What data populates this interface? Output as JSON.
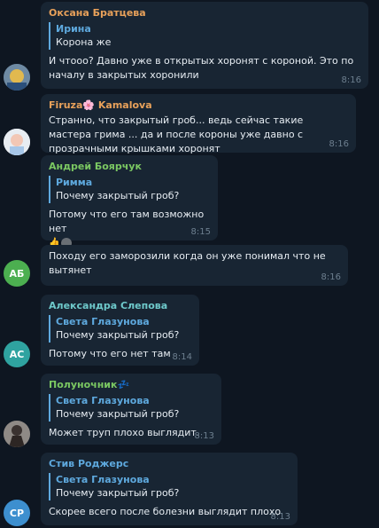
{
  "messages": [
    {
      "name": "Оксана Братцева",
      "name_color": "#e8a15a",
      "quote_name": "Ирина",
      "quote_text": "Корона же",
      "text": "И чтооо? Давно уже в открытых хоронят с короной. Это по началу в закрытых хоронили",
      "time": "8:16"
    },
    {
      "name": "Firuza🌸 Kamalova",
      "name_color": "#e8a15a",
      "text": "Странно, что закрытый гроб... ведь сейчас такие мастера грима ... да и после короны уже давно с прозрачными крышками хоронят",
      "time": "8:16"
    },
    {
      "name": "Андрей Боярчук",
      "name_color": "#7bc862",
      "quote_name": "Римма",
      "quote_text": "Почему закрытый гроб?",
      "text": "Потому что его там возможно нет",
      "reaction": "👍",
      "time": "8:15"
    },
    {
      "avatar_initials": "АБ",
      "avatar_color": "#4caf50",
      "text": "Походу его заморозили когда он уже понимал что не вытянет",
      "time": "8:16"
    },
    {
      "avatar_initials": "АС",
      "avatar_color": "#2fa3a0",
      "name": "Александра Слепова",
      "name_color": "#6ec9cb",
      "quote_name": "Света Глазунова",
      "quote_text": "Почему закрытый гроб?",
      "text": "Потому что его нет там",
      "time": "8:14"
    },
    {
      "name": "Полуночник💤",
      "name_color": "#7bc862",
      "quote_name": "Света Глазунова",
      "quote_text": "Почему закрытый гроб?",
      "text": "Может труп плохо выглядит.",
      "time": "8:13"
    },
    {
      "avatar_initials": "СР",
      "avatar_color": "#3d8fcf",
      "name": "Стив Роджерс",
      "name_color": "#5ea9de",
      "quote_name": "Света Глазунова",
      "quote_text": "Почему закрытый гроб?",
      "text": "Скорее всего после болезни выглядит плохо",
      "time": "8:13"
    }
  ]
}
